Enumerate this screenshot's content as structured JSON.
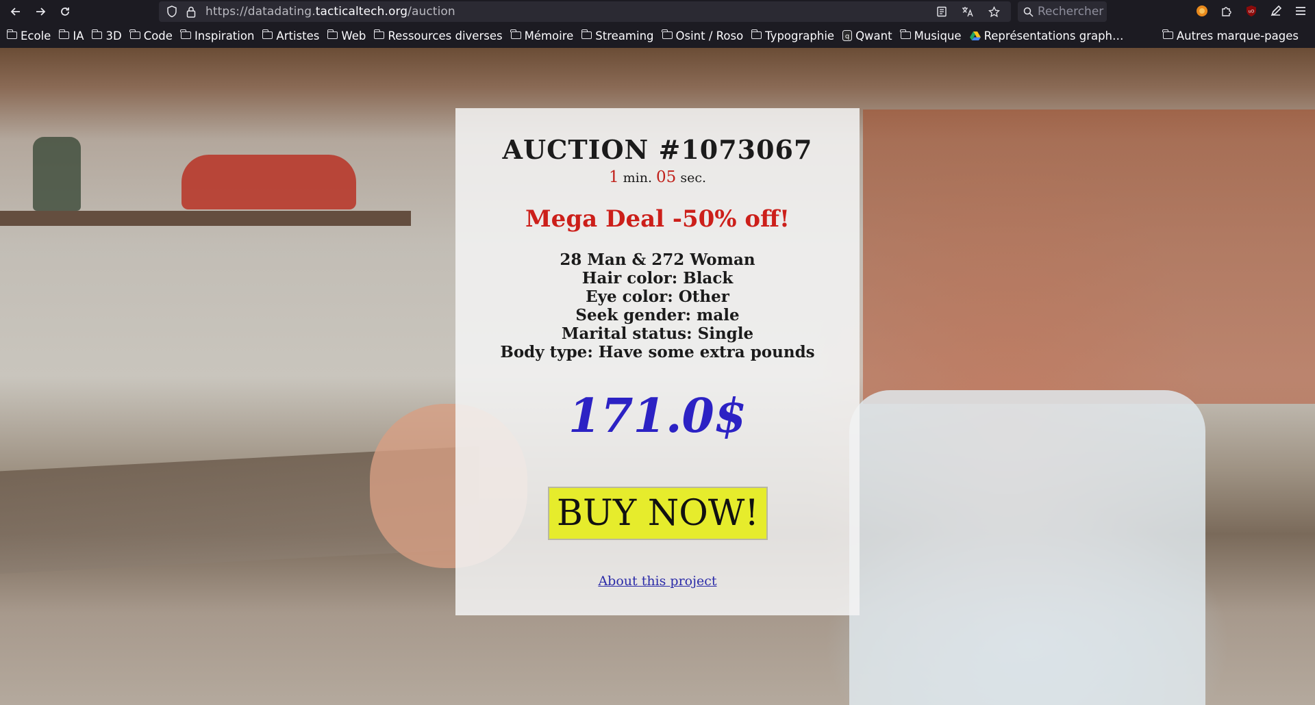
{
  "browser": {
    "url_prefix": "https://datadating.",
    "url_host": "tacticaltech.org",
    "url_path": "/auction",
    "search_placeholder": "Rechercher",
    "icons": {
      "back": "back-arrow-icon",
      "forward": "forward-arrow-icon",
      "reload": "reload-icon",
      "shield": "shield-icon",
      "lock": "lock-icon",
      "reader": "reader-view-icon",
      "translate": "translate-icon",
      "bookmark_star": "star-icon",
      "search": "search-icon",
      "menu": "hamburger-menu-icon"
    }
  },
  "bookmarks": {
    "items": [
      {
        "label": "Ecole",
        "icon": "folder-icon"
      },
      {
        "label": "IA",
        "icon": "folder-icon"
      },
      {
        "label": "3D",
        "icon": "folder-icon"
      },
      {
        "label": "Code",
        "icon": "folder-icon"
      },
      {
        "label": "Inspiration",
        "icon": "folder-icon"
      },
      {
        "label": "Artistes",
        "icon": "folder-icon"
      },
      {
        "label": "Web",
        "icon": "folder-icon"
      },
      {
        "label": "Ressources diverses",
        "icon": "folder-icon"
      },
      {
        "label": "Mémoire",
        "icon": "folder-icon"
      },
      {
        "label": "Streaming",
        "icon": "folder-icon"
      },
      {
        "label": "Osint / Roso",
        "icon": "folder-icon"
      },
      {
        "label": "Typographie",
        "icon": "folder-icon"
      },
      {
        "label": "Qwant",
        "icon": "qwant-icon"
      },
      {
        "label": "Musique",
        "icon": "folder-icon"
      },
      {
        "label": "Représentations graph…",
        "icon": "drive-icon"
      }
    ],
    "other": "Autres marque-pages"
  },
  "auction": {
    "title": "AUCTION #1073067",
    "timer_min": "1",
    "timer_min_unit": "min.",
    "timer_sec": "05",
    "timer_sec_unit": "sec.",
    "deal": "Mega Deal -50% off!",
    "details": [
      "28 Man & 272 Woman",
      "Hair color: Black",
      "Eye color: Other",
      "Seek gender: male",
      "Marital status: Single",
      "Body type: Have some extra pounds"
    ],
    "price": "171.0$",
    "buy_label": "BUY NOW!",
    "about_link": "About this project"
  },
  "colors": {
    "deal_red": "#cc1f1a",
    "timer_red": "#c0201a",
    "price_blue": "#2c22c4",
    "buy_yellow": "#e6ec2c",
    "link_blue": "#2b2ba8"
  }
}
